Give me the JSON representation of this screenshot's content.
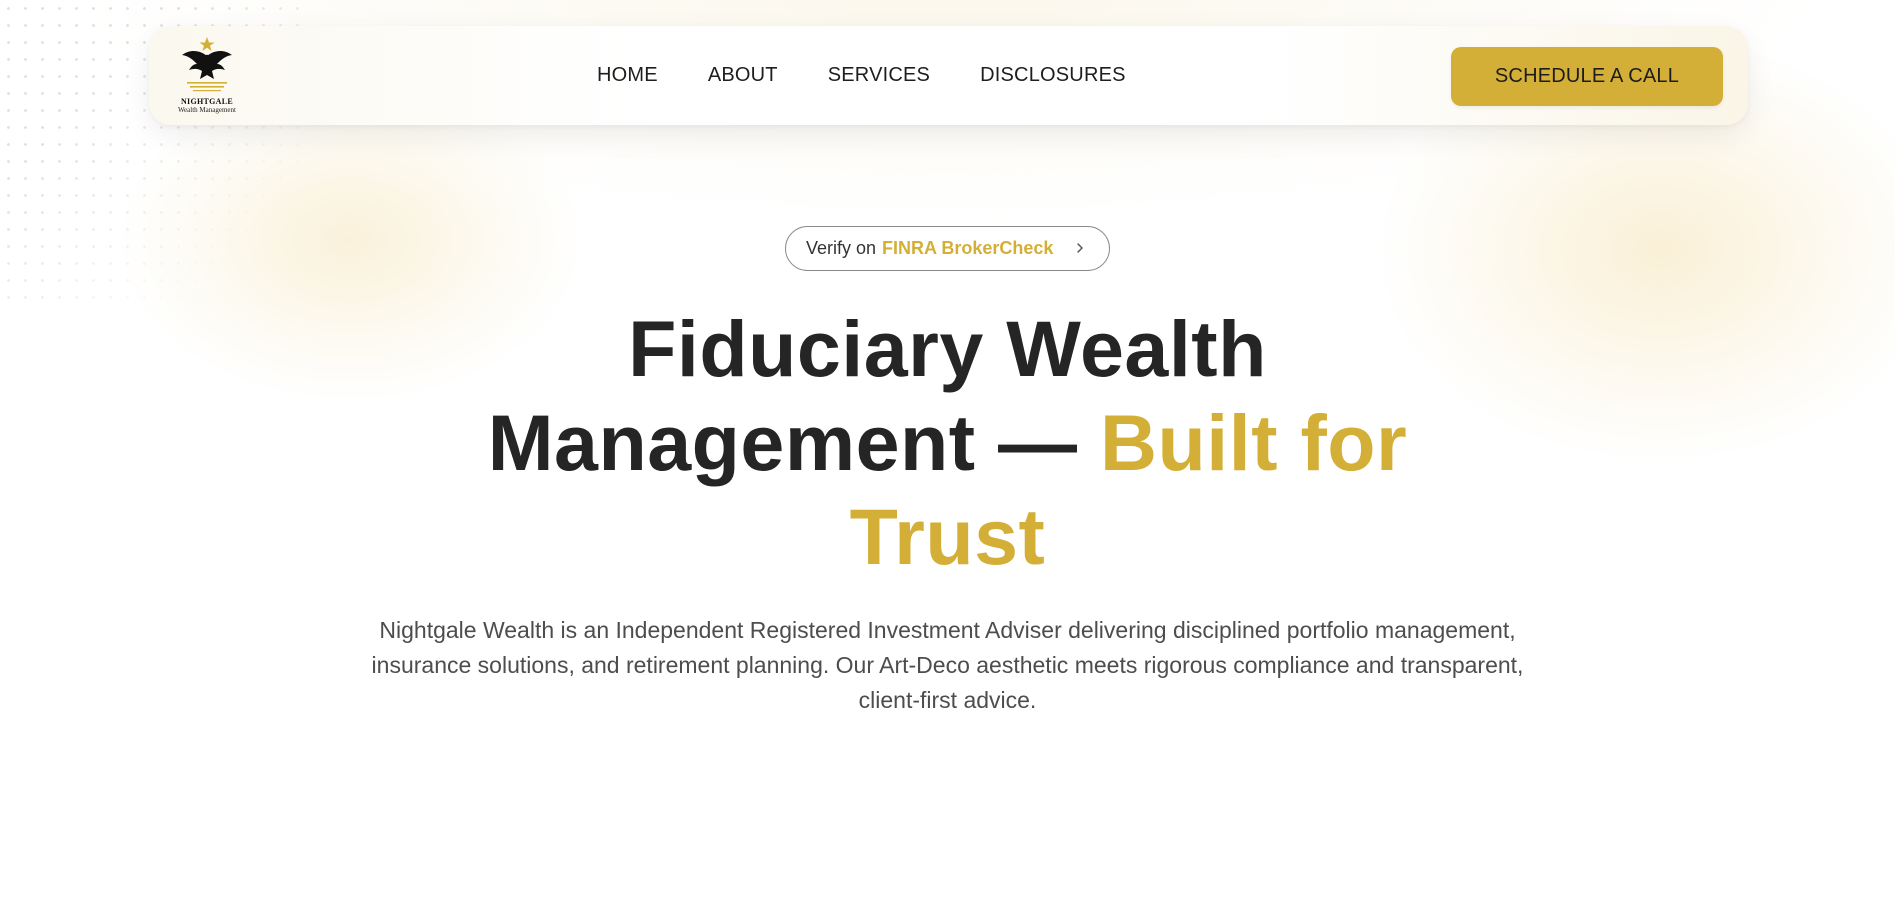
{
  "header": {
    "logo": {
      "name": "NIGHTGALE",
      "subtitle": "Wealth Management",
      "icon": "eagle-star-icon"
    },
    "nav": [
      {
        "label": "HOME"
      },
      {
        "label": "ABOUT"
      },
      {
        "label": "SERVICES"
      },
      {
        "label": "DISCLOSURES"
      }
    ],
    "cta_label": "SCHEDULE A CALL"
  },
  "hero": {
    "verify": {
      "prefix": "Verify on",
      "brand": "FINRA BrokerCheck",
      "icon": "chevron-right-icon"
    },
    "title": {
      "line1": "Fiduciary Wealth",
      "line2": "Management —",
      "accent": "Built for Trust"
    },
    "description": "Nightgale Wealth is an Independent Registered Investment Adviser delivering disciplined portfolio management, insurance solutions, and retirement planning. Our Art-Deco aesthetic meets rigorous compliance and transparent, client-first advice."
  },
  "colors": {
    "accent": "#d4af37",
    "text_dark": "#252525",
    "text_body": "#4d4d4d",
    "background": "#ffffff"
  }
}
